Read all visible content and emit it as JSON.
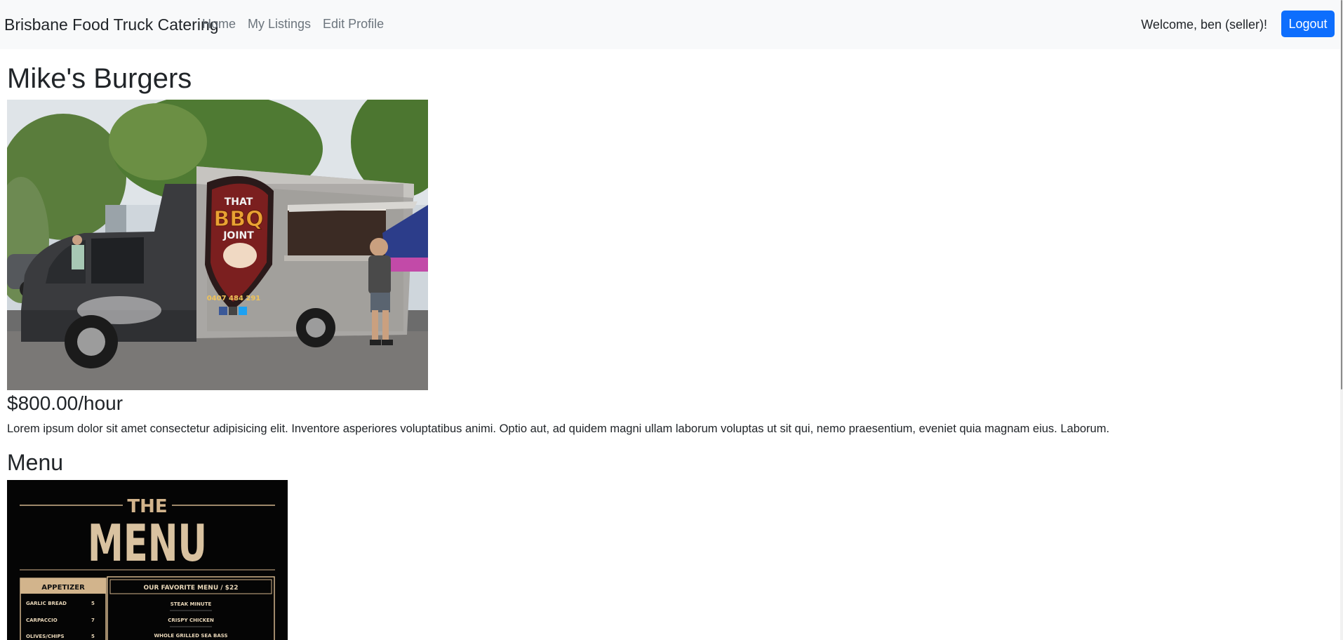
{
  "navbar": {
    "brand": "Brisbane Food Truck Catering",
    "links": [
      "Home",
      "My Listings",
      "Edit Profile"
    ],
    "welcome": "Welcome, ben (seller)!",
    "logout_label": "Logout"
  },
  "listing": {
    "title": "Mike's Burgers",
    "photo_signage": {
      "line1": "THAT",
      "line2": "BBQ",
      "line3": "JOINT",
      "phone": "0407 484 291"
    },
    "price": "$800.00/hour",
    "description": "Lorem ipsum dolor sit amet consectetur adipisicing elit. Inventore asperiores voluptatibus animi. Optio aut, ad quidem magni ullam laborum voluptas ut sit qui, nemo praesentium, eveniet quia magnam eius. Laborum.",
    "menu_heading": "Menu"
  },
  "menu_image": {
    "the": "THE",
    "menu": "MENU",
    "appetizer_title": "APPETIZER",
    "appetizers": [
      {
        "name": "GARLIC BREAD",
        "price": "5"
      },
      {
        "name": "CARPACCIO",
        "price": "7"
      },
      {
        "name": "OLIVES/CHIPS",
        "price": "5"
      }
    ],
    "favorites_title": "OUR FAVORITE MENU / $22",
    "favorites": [
      "STEAK MINUTE",
      "CRISPY CHICKEN",
      "WHOLE GRILLED SEA BASS"
    ]
  },
  "colors": {
    "navbar_bg": "#f8f9fa",
    "primary": "#0d6efd",
    "nav_link": "#6c757d",
    "menu_gold": "#d2b48c"
  }
}
